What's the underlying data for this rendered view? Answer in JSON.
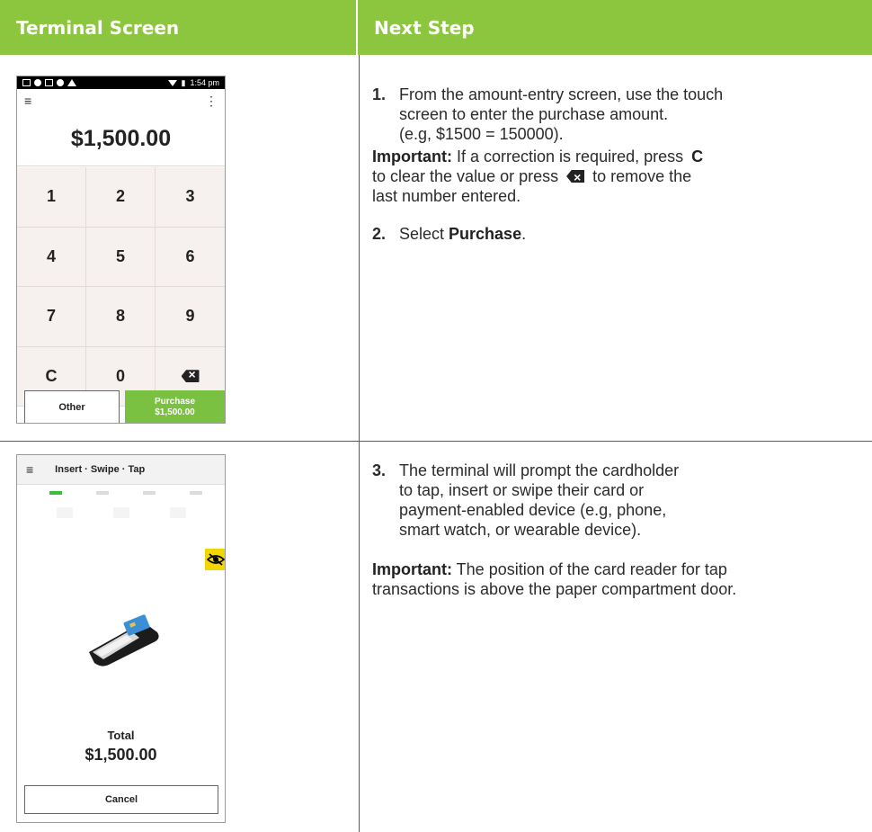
{
  "header": {
    "left": "Terminal Screen",
    "right": "Next Step"
  },
  "screen1": {
    "status_time": "1:54 pm",
    "amount": "$1,500.00",
    "keys": [
      "1",
      "2",
      "3",
      "4",
      "5",
      "6",
      "7",
      "8",
      "9",
      "C",
      "0"
    ],
    "other_label": "Other",
    "purchase_label": "Purchase",
    "purchase_amount": "$1,500.00"
  },
  "screen2": {
    "title": "Insert · Swipe · Tap",
    "total_label": "Total",
    "total_amount": "$1,500.00",
    "cancel_label": "Cancel"
  },
  "steps": {
    "step1_num": "1.",
    "step1_line1": "From the amount-entry screen, use the touch",
    "step1_line2": "screen to enter the purchase amount.",
    "step1_line3": "(e.g, $1500 = 150000).",
    "important_label": "Important:",
    "important1_a": " If a correction is required, press ",
    "important1_key": "C",
    "important1_b": "to clear the value or press ",
    "important1_c": " to remove the",
    "important1_d": "last number entered.",
    "step2_num": "2.",
    "step2_text": "Select ",
    "step2_bold": "Purchase",
    "step2_end": ".",
    "step3_num": "3.",
    "step3_line1": "The terminal will prompt the cardholder",
    "step3_line2": "to tap, insert or swipe their card or",
    "step3_line3": "payment-enabled device (e.g, phone,",
    "step3_line4": "smart watch, or wearable device).",
    "important2_text1": " The position of the card reader for tap",
    "important2_text2": "transactions is above the paper compartment door."
  }
}
